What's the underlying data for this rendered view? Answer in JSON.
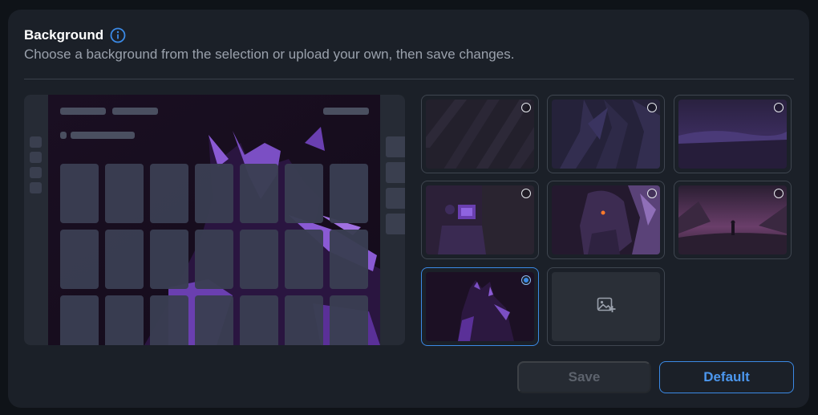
{
  "header": {
    "title": "Background",
    "info_icon": "info-circle-icon",
    "subtitle": "Choose a background from the selection or upload your own, then save changes."
  },
  "backgrounds": [
    {
      "name": "dark-diagonal-stripes",
      "selected": false
    },
    {
      "name": "dark-folded-shapes",
      "selected": false
    },
    {
      "name": "purple-night-landscape",
      "selected": false
    },
    {
      "name": "purple-room-desk",
      "selected": false
    },
    {
      "name": "purple-character-portrait",
      "selected": false
    },
    {
      "name": "pink-sky-mountain-figure",
      "selected": false
    },
    {
      "name": "purple-cat-silhouette",
      "selected": true
    }
  ],
  "upload": {
    "icon": "image-add-icon"
  },
  "buttons": {
    "save_label": "Save",
    "default_label": "Default",
    "save_enabled": false
  },
  "colors": {
    "accent": "#3b8ae6",
    "panel": "#1b2028",
    "page": "#0f1318"
  }
}
